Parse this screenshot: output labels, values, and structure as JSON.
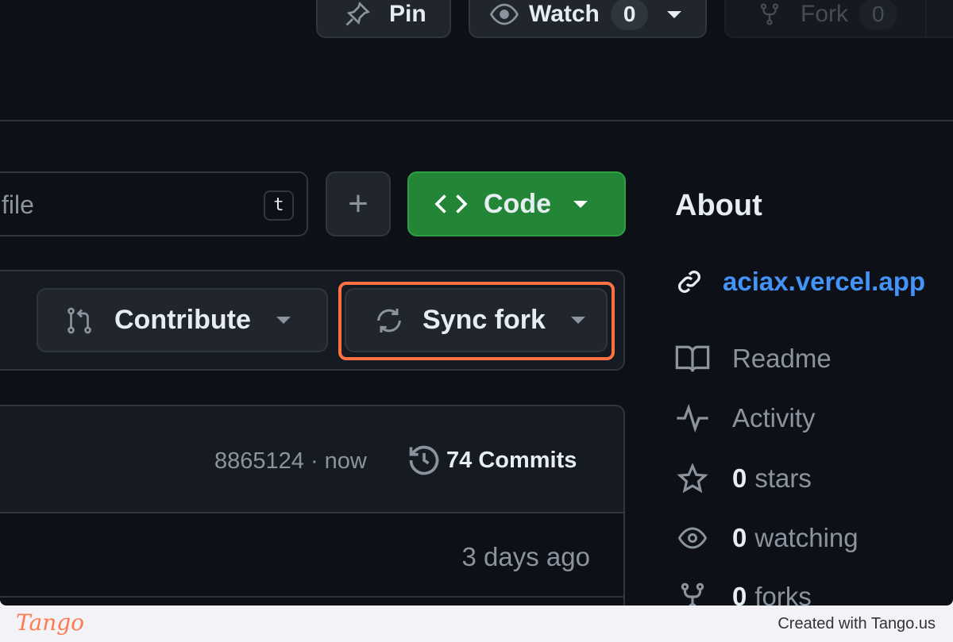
{
  "header": {
    "pin_label": "Pin",
    "watch_label": "Watch",
    "watch_count": "0",
    "fork_label": "Fork",
    "fork_count": "0"
  },
  "toolbar": {
    "search_placeholder": "file",
    "search_shortcut": "t",
    "add_label": "+",
    "code_label": "Code"
  },
  "branch_bar": {
    "contribute_label": "Contribute",
    "sync_fork_label": "Sync fork"
  },
  "commits": {
    "hash_time": "8865124 · now",
    "commit_count": "74 Commits",
    "row_time": "3 days ago"
  },
  "about": {
    "title": "About",
    "link": "aciax.vercel.app",
    "readme": "Readme",
    "activity": "Activity",
    "stars_count": "0",
    "stars_label": "stars",
    "watching_count": "0",
    "watching_label": "watching",
    "forks_count": "0",
    "forks_label": "forks"
  },
  "footer": {
    "brand": "Tango",
    "credit": "Created with Tango.us"
  },
  "colors": {
    "background": "#0d1117",
    "accent_green": "#238636",
    "link": "#4493f8",
    "highlight": "#ff7043"
  }
}
